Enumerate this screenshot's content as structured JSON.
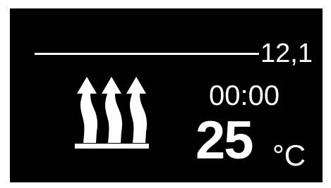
{
  "display": {
    "level_value": "12,1",
    "timer": "00:00",
    "temperature": "25",
    "temperature_unit": "°C",
    "icon": "heating-arrows-icon",
    "background_color": "#000000",
    "foreground_color": "#ffffff"
  }
}
